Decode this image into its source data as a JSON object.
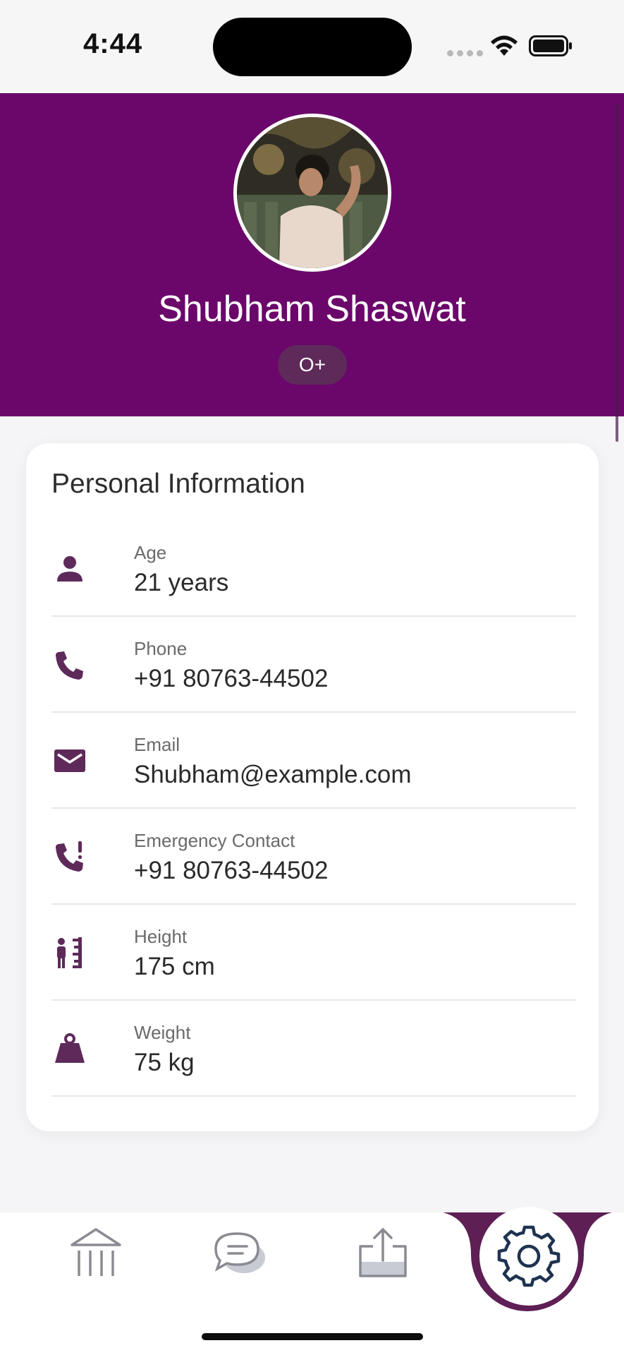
{
  "status_bar": {
    "time": "4:44"
  },
  "profile": {
    "name": "Shubham Shaswat",
    "blood_group": "O+"
  },
  "colors": {
    "header": "#6b066b",
    "icon": "#5e2a5a",
    "nav_icon": "#8a8a92"
  },
  "personal_info": {
    "title": "Personal Information",
    "rows": [
      {
        "icon": "person-icon",
        "label": "Age",
        "value": "21 years"
      },
      {
        "icon": "phone-icon",
        "label": "Phone",
        "value": "+91 80763-44502"
      },
      {
        "icon": "mail-icon",
        "label": "Email",
        "value": "Shubham@example.com"
      },
      {
        "icon": "emergency-phone-icon",
        "label": "Emergency Contact",
        "value": "+91 80763-44502"
      },
      {
        "icon": "height-icon",
        "label": "Height",
        "value": "175 cm"
      },
      {
        "icon": "weight-icon",
        "label": "Weight",
        "value": "75 kg"
      }
    ]
  },
  "bottom_nav": {
    "items": [
      "bank-icon",
      "chat-icon",
      "upload-icon",
      "gear-icon"
    ],
    "active": "gear-icon"
  }
}
